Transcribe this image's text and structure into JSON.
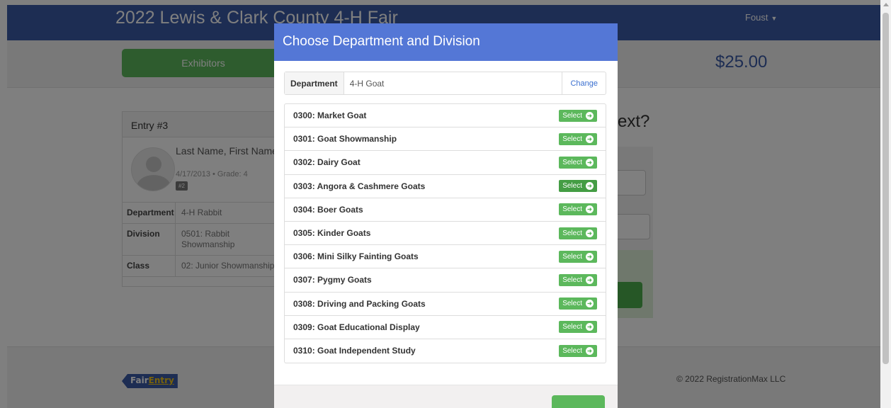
{
  "navbar": {
    "title": "2022 Lewis & Clark County 4-H Fair",
    "user": "Foust"
  },
  "subbar": {
    "exhibitors_label": "Exhibitors",
    "total": "$25.00"
  },
  "entry": {
    "heading": "Entry #3",
    "name": "Last Name, First Name",
    "dob_grade": "4/17/2013 • Grade: 4",
    "badge": "#2",
    "rows": [
      {
        "key": "Department",
        "value": "4-H Rabbit"
      },
      {
        "key": "Division",
        "value": "0501: Rabbit Showmanship"
      },
      {
        "key": "Class",
        "value": "02: Junior Showmanship"
      }
    ]
  },
  "right_panel": {
    "heading": "ext?"
  },
  "footer": {
    "logo_part1": "Fair",
    "logo_part2": "Entry",
    "copyright": "© 2022 RegistrationMax LLC"
  },
  "modal": {
    "title": "Choose Department and Division",
    "department_label": "Department",
    "department_value": "4-H Goat",
    "change_label": "Change",
    "select_label": "Select",
    "divisions": [
      {
        "name": "0300: Market Goat"
      },
      {
        "name": "0301: Goat Showmanship"
      },
      {
        "name": "0302: Dairy Goat"
      },
      {
        "name": "0303: Angora & Cashmere Goats"
      },
      {
        "name": "0304: Boer Goats"
      },
      {
        "name": "0305: Kinder Goats"
      },
      {
        "name": "0306: Mini Silky Fainting Goats"
      },
      {
        "name": "0307: Pygmy Goats"
      },
      {
        "name": "0308: Driving and Packing Goats"
      },
      {
        "name": "0309: Goat Educational Display"
      },
      {
        "name": "0310: Goat Independent Study"
      }
    ]
  },
  "colors": {
    "brand": "#3a5aa6",
    "modal_header": "#5477d6",
    "success": "#5cb85c"
  },
  "icons": {
    "select": "arrow-circle-right-icon",
    "user_caret": "caret-down-icon",
    "avatar": "user-silhouette-icon"
  }
}
